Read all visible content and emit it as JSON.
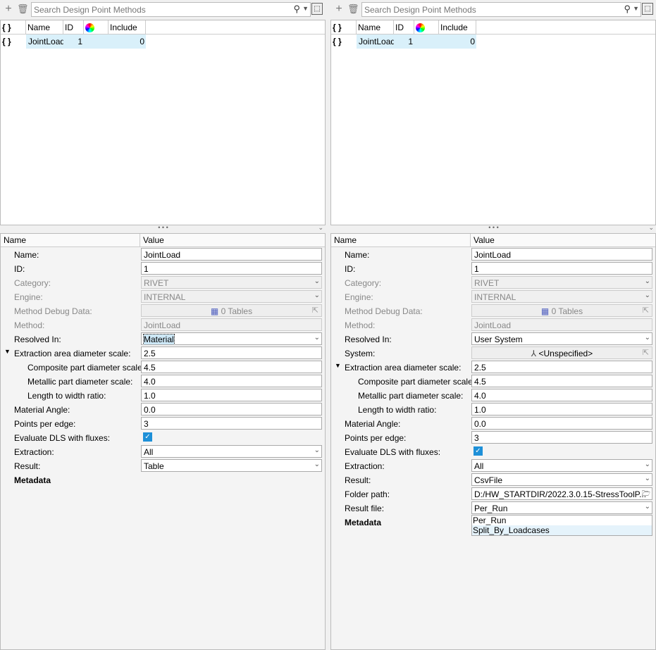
{
  "toolbar": {
    "search_placeholder": "Search Design Point Methods",
    "icons": [
      "plus-icon",
      "trash-icon",
      "search-icon",
      "chevron-down-icon",
      "pick-icon"
    ]
  },
  "grid": {
    "headers": [
      "{ }",
      "Name",
      "ID",
      "",
      "Include"
    ],
    "rows": [
      {
        "icon": "{ }",
        "name": "JointLoad",
        "id": "1",
        "include": "0"
      }
    ]
  },
  "props_header": {
    "name": "Name",
    "value": "Value"
  },
  "left": {
    "rows": [
      {
        "label": "Name:",
        "type": "text",
        "value": "JointLoad"
      },
      {
        "label": "ID:",
        "type": "text",
        "value": "1"
      },
      {
        "label": "Category:",
        "type": "select",
        "value": "RIVET",
        "disabled": true
      },
      {
        "label": "Engine:",
        "type": "select",
        "value": "INTERNAL",
        "disabled": true
      },
      {
        "label": "Method Debug Data:",
        "type": "button",
        "value": "0 Tables",
        "disabled": true
      },
      {
        "label": "Method:",
        "type": "text",
        "value": "JointLoad",
        "disabled": true
      },
      {
        "label": "Resolved In:",
        "type": "select",
        "value": "Material",
        "focused": true
      },
      {
        "label": "Extraction area diameter scale:",
        "type": "text",
        "value": "2.5",
        "expander": true
      },
      {
        "label": "Composite part diameter scale:",
        "type": "text",
        "value": "4.5",
        "sub": true
      },
      {
        "label": "Metallic part diameter scale:",
        "type": "text",
        "value": "4.0",
        "sub": true
      },
      {
        "label": "Length to width ratio:",
        "type": "text",
        "value": "1.0",
        "sub": true
      },
      {
        "label": "Material Angle:",
        "type": "text",
        "value": "0.0"
      },
      {
        "label": "Points per edge:",
        "type": "text",
        "value": "3"
      },
      {
        "label": "Evaluate DLS with fluxes:",
        "type": "checkbox",
        "checked": true
      },
      {
        "label": "Extraction:",
        "type": "select",
        "value": "All"
      },
      {
        "label": "Result:",
        "type": "select",
        "value": "Table"
      },
      {
        "label": "Metadata",
        "type": "group"
      }
    ]
  },
  "right": {
    "rows": [
      {
        "label": "Name:",
        "type": "text",
        "value": "JointLoad"
      },
      {
        "label": "ID:",
        "type": "text",
        "value": "1"
      },
      {
        "label": "Category:",
        "type": "select",
        "value": "RIVET",
        "disabled": true
      },
      {
        "label": "Engine:",
        "type": "select",
        "value": "INTERNAL",
        "disabled": true
      },
      {
        "label": "Method Debug Data:",
        "type": "button",
        "value": "0 Tables",
        "disabled": true
      },
      {
        "label": "Method:",
        "type": "text",
        "value": "JointLoad",
        "disabled": true
      },
      {
        "label": "Resolved In:",
        "type": "select",
        "value": "User System"
      },
      {
        "label": "System:",
        "type": "button",
        "value": "<Unspecified>"
      },
      {
        "label": "Extraction area diameter scale:",
        "type": "text",
        "value": "2.5",
        "expander": true
      },
      {
        "label": "Composite part diameter scale:",
        "type": "text",
        "value": "4.5",
        "sub": true
      },
      {
        "label": "Metallic part diameter scale:",
        "type": "text",
        "value": "4.0",
        "sub": true
      },
      {
        "label": "Length to width ratio:",
        "type": "text",
        "value": "1.0",
        "sub": true
      },
      {
        "label": "Material Angle:",
        "type": "text",
        "value": "0.0"
      },
      {
        "label": "Points per edge:",
        "type": "text",
        "value": "3"
      },
      {
        "label": "Evaluate DLS with fluxes:",
        "type": "checkbox",
        "checked": true
      },
      {
        "label": "Extraction:",
        "type": "select",
        "value": "All"
      },
      {
        "label": "Result:",
        "type": "select",
        "value": "CsvFile"
      },
      {
        "label": "Folder path:",
        "type": "folder",
        "value": "D:/HW_STARTDIR/2022.3.0.15-StressToolP..."
      },
      {
        "label": "Result file:",
        "type": "select",
        "value": "Per_Run",
        "open": true,
        "options": [
          "Per_Run",
          "Split_By_Loadcases"
        ]
      },
      {
        "label": "Metadata",
        "type": "group"
      }
    ]
  }
}
